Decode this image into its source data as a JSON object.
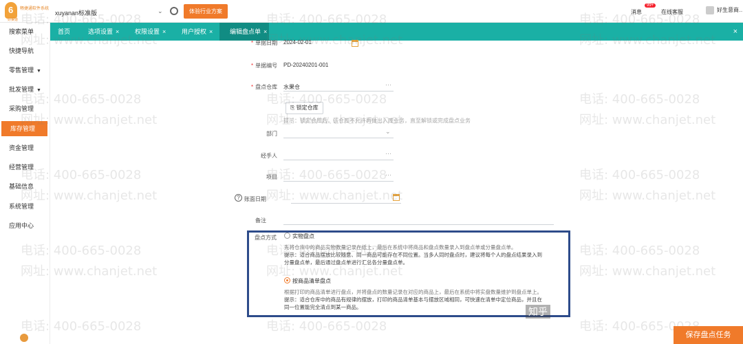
{
  "header": {
    "logo_line1": "畅捷通软件系统",
    "logo_line2": "好渠道",
    "account": "xuyanan标准版",
    "trial_button": "体验行业方案",
    "message": "消息",
    "message_badge": "99+",
    "service": "在线客服",
    "user": "好生意商…"
  },
  "sidebar": {
    "items": [
      {
        "label": "搜索菜单"
      },
      {
        "label": "快捷导航"
      },
      {
        "label": "零售管理",
        "caret": "▼"
      },
      {
        "label": "批发管理",
        "caret": "▼"
      },
      {
        "label": "采购管理"
      },
      {
        "label": "库存管理"
      },
      {
        "label": "资金管理"
      },
      {
        "label": "经营管理"
      },
      {
        "label": "基础信息"
      },
      {
        "label": "系统管理"
      },
      {
        "label": "应用中心"
      }
    ]
  },
  "tabs": [
    {
      "label": "首页",
      "close": ""
    },
    {
      "label": "选项设置",
      "close": "×"
    },
    {
      "label": "权限设置",
      "close": "×"
    },
    {
      "label": "用户授权",
      "close": "×"
    },
    {
      "label": "编辑盘点单",
      "close": "×"
    }
  ],
  "tabbar_close": "×",
  "form": {
    "date_label": "单据日期",
    "date_value": "2024-02-01",
    "number_label": "单据编号",
    "number_value": "PD-20240201-001",
    "warehouse_label": "盘点仓库",
    "warehouse_value": "水果仓",
    "lock_button": "锁定仓库",
    "lock_hint": "提示：锁定仓库后，该仓库不允许再做出入库业务，直至解锁或完成盘点业务",
    "dept_label": "部门",
    "handler_label": "经手人",
    "project_label": "项目",
    "account_date_label": "账面日期",
    "remark_label": "备注",
    "method_label": "盘点方式",
    "option1_label": "实物盘点",
    "option1_desc1": "先将仓库中的商品实物数量记录在纸上，最后在系统中将商品和盘点数量录入到盘点单或分量盘点单。",
    "option1_desc2": "提示：适合商品摆放比较随意、同一商品可能存在不同位置。当多人同时盘点时，建议将每个人的盘点结果录入到",
    "option1_desc3": "分量盘点单，最后通过盘点单进行汇总各分量盘点单。",
    "option2_label": "按商品清单盘点",
    "option2_desc1": "根据打印的商品清单进行盘点，并将盘点的数量记录在对应的商品上，最后在系统中将实盘数量维护到盘点单上。",
    "option2_desc2": "提示：适合仓库中的商品有规律的摆放，打印的商品清单基本与摆放区域相同，可快速在清单中定位商品，并且在",
    "option2_desc3": "同一位置能完全清点到某一商品。"
  },
  "watermark": {
    "phone": "电话: 400-665-0028",
    "site": "网址: www.chanjet.net"
  },
  "caption": "知乎",
  "save_button": "保存盘点任务"
}
